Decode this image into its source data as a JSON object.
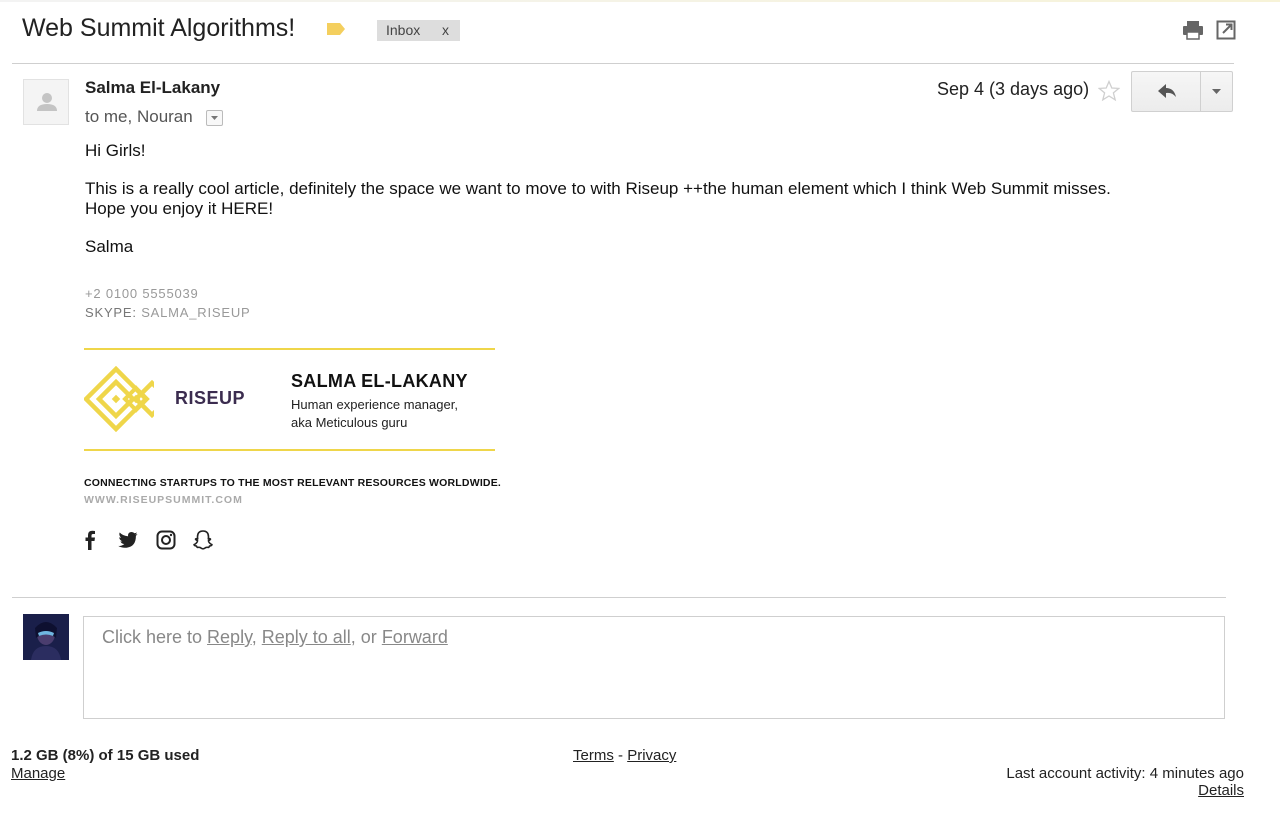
{
  "thread": {
    "subject": "Web Summit Algorithms!",
    "label": "Inbox",
    "label_remove": "x",
    "label_color": "#f4cf5e"
  },
  "message": {
    "sender": "Salma El-Lakany",
    "recipients": "to me, Nouran",
    "date": "Sep 4 (3 days ago)",
    "greeting": "Hi Girls!",
    "body_line1": "This is a really cool article, definitely the space we want to move to with Riseup ++the human element which I think Web Summit misses.",
    "body_line2": "Hope you enjoy it HERE!",
    "signoff": "Salma"
  },
  "signature": {
    "phone": "+2 0100 5555039",
    "skype_key": "SKYPE:",
    "skype_value": "SALMA_RISEUP",
    "brand": "RISEUP",
    "name": "SALMA EL-LAKANY",
    "role_line1": "Human experience manager,",
    "role_line2": "aka Meticulous guru",
    "tagline": "CONNECTING STARTUPS TO THE MOST RELEVANT RESOURCES WORLDWIDE.",
    "website": "WWW.RISEUPSUMMIT.COM",
    "accent_color": "#efd64a",
    "brand_color": "#3b2c4f",
    "social_icons": [
      "facebook-icon",
      "twitter-icon",
      "instagram-icon",
      "snapchat-icon"
    ]
  },
  "reply": {
    "prefix": "Click here to ",
    "reply": "Reply",
    "sep1": ", ",
    "reply_all": "Reply to all",
    "sep2": ", or ",
    "forward": "Forward"
  },
  "footer": {
    "storage": "1.2 GB (8%) of 15 GB used",
    "manage": "Manage",
    "terms": "Terms",
    "dash": " - ",
    "privacy": "Privacy",
    "activity": "Last account activity: 4 minutes ago",
    "details": "Details"
  }
}
